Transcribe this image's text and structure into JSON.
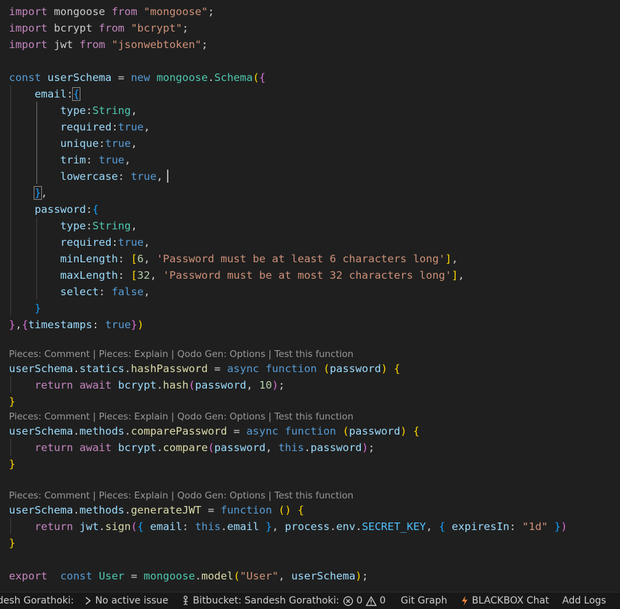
{
  "editor": {
    "lines": {
      "l1": [
        "import",
        " mongoose ",
        "from",
        " ",
        "\"mongoose\"",
        ";"
      ],
      "l2": [
        "import",
        " bcrypt ",
        "from",
        " ",
        "\"bcrypt\"",
        ";"
      ],
      "l3": [
        "import",
        " jwt ",
        "from",
        " ",
        "\"jsonwebtoken\"",
        ";"
      ],
      "l5": [
        "const",
        " ",
        "userSchema",
        " = ",
        "new",
        " ",
        "mongoose",
        ".",
        "Schema",
        "(",
        "{"
      ],
      "l6": [
        "    ",
        "email",
        ":",
        "{"
      ],
      "l7": [
        "        ",
        "type",
        ":",
        "String",
        ","
      ],
      "l8": [
        "        ",
        "required",
        ":",
        "true",
        ","
      ],
      "l9": [
        "        ",
        "unique",
        ":",
        "true",
        ","
      ],
      "l10": [
        "        ",
        "trim",
        ": ",
        "true",
        ","
      ],
      "l11": [
        "        ",
        "lowercase",
        ": ",
        "true",
        ","
      ],
      "l12": [
        "    ",
        "}",
        ","
      ],
      "l13": [
        "    ",
        "password",
        ":",
        "{"
      ],
      "l14": [
        "        ",
        "type",
        ":",
        "String",
        ","
      ],
      "l15": [
        "        ",
        "required",
        ":",
        "true",
        ","
      ],
      "l16": [
        "        ",
        "minLength",
        ": ",
        "[",
        "6",
        ", ",
        "'Password must be at least 6 characters long'",
        "]",
        ","
      ],
      "l17": [
        "        ",
        "maxLength",
        ": ",
        "[",
        "32",
        ", ",
        "'Password must be at most 32 characters long'",
        "]",
        ","
      ],
      "l18": [
        "        ",
        "select",
        ": ",
        "false",
        ","
      ],
      "l19": [
        "    ",
        "}"
      ],
      "l20": [
        "}",
        ",",
        "{",
        "timestamps",
        ": ",
        "true",
        "}",
        ")"
      ],
      "l22": [
        "userSchema",
        ".",
        "statics",
        ".",
        "hashPassword",
        " = ",
        "async",
        " ",
        "function",
        " ",
        "(",
        "password",
        ")",
        " ",
        "{"
      ],
      "l23": [
        "    ",
        "return",
        " ",
        "await",
        " ",
        "bcrypt",
        ".",
        "hash",
        "(",
        "password",
        ", ",
        "10",
        ")",
        ";"
      ],
      "l24": [
        "}"
      ],
      "l25": [
        "userSchema",
        ".",
        "methods",
        ".",
        "comparePassword",
        " = ",
        "async",
        " ",
        "function",
        " ",
        "(",
        "password",
        ")",
        " ",
        "{"
      ],
      "l26": [
        "    ",
        "return",
        " ",
        "await",
        " ",
        "bcrypt",
        ".",
        "compare",
        "(",
        "password",
        ", ",
        "this",
        ".",
        "password",
        ")",
        ";"
      ],
      "l27": [
        "}"
      ],
      "l29": [
        "userSchema",
        ".",
        "methods",
        ".",
        "generateJWT",
        " = ",
        "function",
        " ",
        "(",
        ")",
        " ",
        "{"
      ],
      "l30": [
        "    ",
        "return",
        " ",
        "jwt",
        ".",
        "sign",
        "(",
        "{",
        " ",
        "email",
        ": ",
        "this",
        ".",
        "email",
        " ",
        "}",
        ", ",
        "process",
        ".",
        "env",
        ".",
        "SECRET_KEY",
        ", ",
        "{",
        " ",
        "expiresIn",
        ": ",
        "\"1d\"",
        " ",
        "}",
        ")"
      ],
      "l31": [
        "}"
      ],
      "l33": [
        "export",
        "  ",
        "const",
        " ",
        "User",
        " = ",
        "mongoose",
        ".",
        "model",
        "(",
        "\"User\"",
        ", ",
        "userSchema",
        ")",
        ";"
      ]
    },
    "codelens": {
      "items": [
        "Pieces: Comment",
        "Pieces: Explain",
        "Qodo Gen: Options",
        "Test this function"
      ],
      "separator": " | "
    }
  },
  "statusbar": {
    "author": "desh Gorathoki:",
    "issue_icon": "chevron-right-icon",
    "issue": "No active issue",
    "bitbucket_icon": "bitbucket-icon",
    "bitbucket": "Bitbucket: Sandesh Gorathoki:",
    "errors_icon": "error-circle-icon",
    "errors": "0",
    "warnings_icon": "warning-triangle-icon",
    "warnings": "0",
    "git_graph": "Git Graph",
    "blackbox_icon": "lightning-icon",
    "blackbox": "BLACKBOX Chat",
    "add_logs": "Add Logs"
  },
  "colors": {
    "background": "#1f1f1f",
    "keyword": "#c586c0",
    "storage": "#569cd6",
    "string": "#ce9178",
    "variable": "#9cdcfe",
    "class": "#4ec9b0",
    "function": "#dcdcaa",
    "number": "#b5cea8"
  }
}
